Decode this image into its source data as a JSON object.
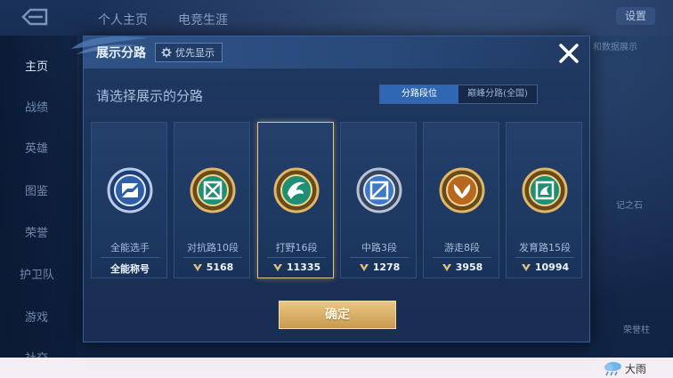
{
  "background": {
    "top_tabs": [
      "个人主页",
      "电竞生涯"
    ],
    "settings_label": "设置",
    "nav_items": [
      "主页",
      "战绩",
      "英雄",
      "图鉴",
      "荣誉",
      "护卫队",
      "游戏",
      "社交"
    ],
    "right_texts": [
      "和数据展示",
      "记之石",
      "荣誉柱"
    ],
    "weather": "大雨"
  },
  "dialog": {
    "title": "展示分路",
    "priority_label": "优先显示",
    "prompt": "请选择展示的分路",
    "tabs": [
      {
        "label": "分路段位",
        "active": true
      },
      {
        "label": "巅峰分路(全国)",
        "active": false
      }
    ],
    "cards": [
      {
        "label": "全能选手",
        "score": "全能称号",
        "emblem": "all-round-emblem-icon",
        "selected": false
      },
      {
        "label": "对抗路10段",
        "score": "5168",
        "emblem": "clash-lane-emblem-icon",
        "selected": false
      },
      {
        "label": "打野16段",
        "score": "11335",
        "emblem": "jungle-emblem-icon",
        "selected": true
      },
      {
        "label": "中路3段",
        "score": "1278",
        "emblem": "mid-lane-emblem-icon",
        "selected": false
      },
      {
        "label": "游走8段",
        "score": "3958",
        "emblem": "roam-emblem-icon",
        "selected": false
      },
      {
        "label": "发育路15段",
        "score": "10994",
        "emblem": "farm-lane-emblem-icon",
        "selected": false
      }
    ],
    "confirm_label": "确定"
  },
  "colors": {
    "accent_blue": "#2f67b3",
    "selected_gold": "#e2c27c",
    "confirm_gold": "#d9b06a"
  }
}
